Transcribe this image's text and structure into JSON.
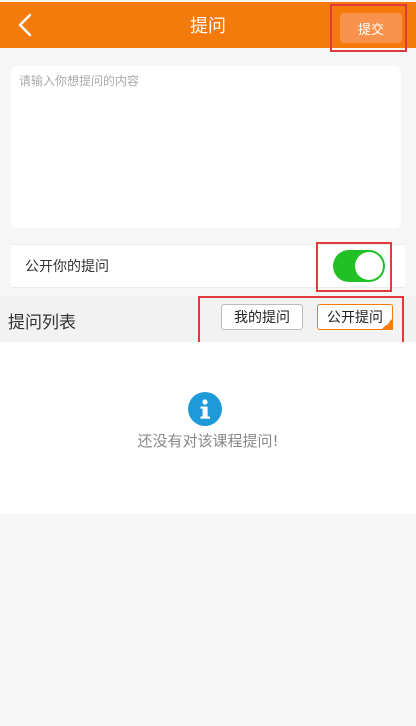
{
  "header": {
    "title": "提问",
    "back_icon": "chevron-left-icon",
    "submit_label": "提交"
  },
  "question": {
    "placeholder": "请输入你想提问的内容",
    "value": ""
  },
  "public_setting": {
    "label": "公开你的提问",
    "enabled": true
  },
  "question_list": {
    "title": "提问列表",
    "tabs": [
      {
        "label": "我的提问",
        "selected": false
      },
      {
        "label": "公开提问",
        "selected": true
      }
    ],
    "empty_icon": "info-icon",
    "empty_message": "还没有对该课程提问!"
  },
  "colors": {
    "brand": "#f57a0c",
    "toggle_on": "#21c125",
    "info": "#1f9ad8"
  }
}
